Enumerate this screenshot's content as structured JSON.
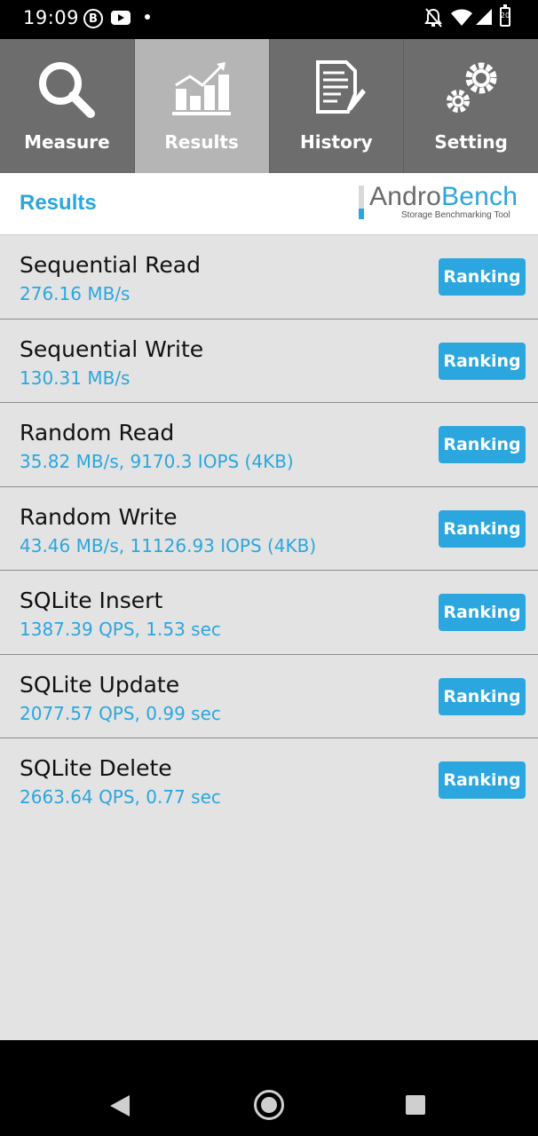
{
  "status_bar": {
    "time": "19:09",
    "battery_level": "20",
    "icons": [
      "b-icon",
      "youtube-icon",
      "notification-dot",
      "bell-off-icon",
      "wifi-icon",
      "signal-icon",
      "battery-icon"
    ]
  },
  "tabs": [
    {
      "label": "Measure",
      "icon": "magnifier-icon",
      "active": false
    },
    {
      "label": "Results",
      "icon": "bar-chart-icon",
      "active": true
    },
    {
      "label": "History",
      "icon": "document-edit-icon",
      "active": false
    },
    {
      "label": "Setting",
      "icon": "gears-icon",
      "active": false
    }
  ],
  "header": {
    "title": "Results",
    "logo_andro": "Andro",
    "logo_bench": "Bench",
    "logo_tagline": "Storage Benchmarking Tool"
  },
  "results": [
    {
      "name": "Sequential Read",
      "value": "276.16 MB/s",
      "button": "Ranking"
    },
    {
      "name": "Sequential Write",
      "value": "130.31 MB/s",
      "button": "Ranking"
    },
    {
      "name": "Random Read",
      "value": "35.82 MB/s, 9170.3 IOPS (4KB)",
      "button": "Ranking"
    },
    {
      "name": "Random Write",
      "value": "43.46 MB/s, 11126.93 IOPS (4KB)",
      "button": "Ranking"
    },
    {
      "name": "SQLite Insert",
      "value": "1387.39 QPS, 1.53 sec",
      "button": "Ranking"
    },
    {
      "name": "SQLite Update",
      "value": "2077.57 QPS, 0.99 sec",
      "button": "Ranking"
    },
    {
      "name": "SQLite Delete",
      "value": "2663.64 QPS, 0.77 sec",
      "button": "Ranking"
    }
  ],
  "colors": {
    "accent": "#2ba6de",
    "tab_bg": "#6d6d6d",
    "tab_active_bg": "#b5b5b5",
    "list_bg": "#e3e3e3"
  }
}
